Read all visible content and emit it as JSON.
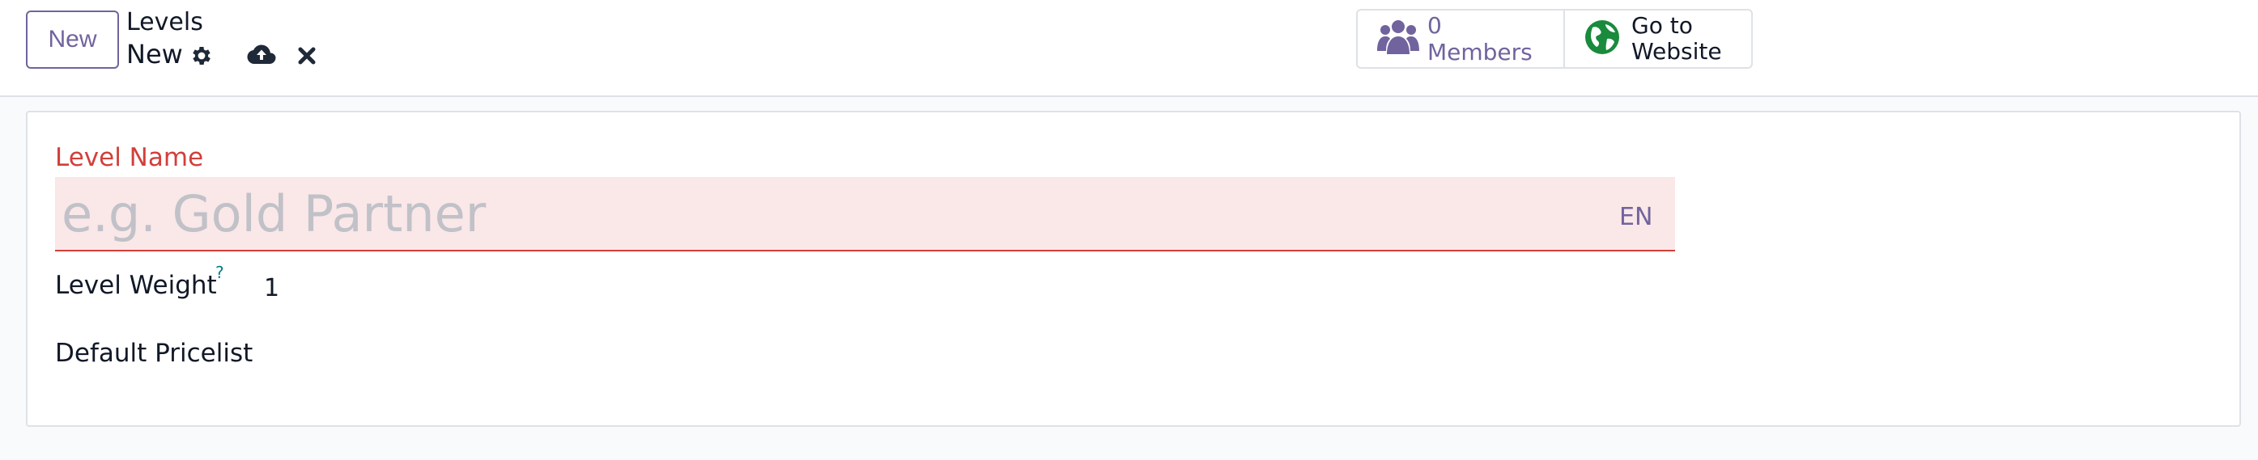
{
  "toolbar": {
    "new_label": "New",
    "breadcrumb_parent": "Levels",
    "breadcrumb_current": "New"
  },
  "icons": {
    "settings": "gear-icon",
    "save": "cloud-upload-icon",
    "discard": "close-icon",
    "members": "users-icon",
    "website": "globe-icon"
  },
  "smart_buttons": {
    "members_label": "0 Members",
    "website_line1": "Go to",
    "website_line2": "Website"
  },
  "form": {
    "level_name_label": "Level Name",
    "level_name_placeholder": "e.g. Gold Partner",
    "level_name_value": "",
    "lang_label": "EN",
    "level_weight_label": "Level Weight",
    "level_weight_tooltip": "?",
    "level_weight_value": "1",
    "default_pricelist_label": "Default Pricelist"
  },
  "colors": {
    "accent": "#71639e",
    "danger": "#d23f3a",
    "required_bg": "#fae7e8",
    "website_green": "#1a8a3c",
    "tooltip": "#017e84"
  }
}
